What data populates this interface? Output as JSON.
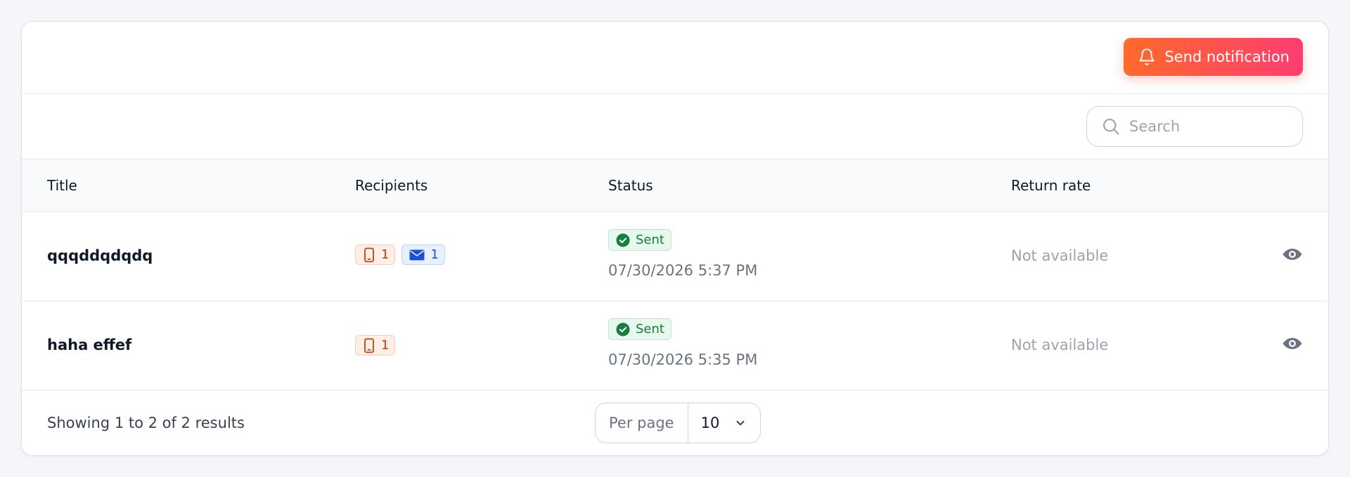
{
  "toolbar": {
    "send_label": "Send notification"
  },
  "search": {
    "placeholder": "Search"
  },
  "table": {
    "columns": {
      "title": "Title",
      "recipients": "Recipients",
      "status": "Status",
      "return_rate": "Return rate"
    },
    "rows": [
      {
        "title": "qqqddqdqdq",
        "recipients": {
          "sms": "1",
          "email": "1"
        },
        "status": "Sent",
        "timestamp": "07/30/2026 5:37 PM",
        "return_rate": "Not available"
      },
      {
        "title": "haha effef",
        "recipients": {
          "sms": "1"
        },
        "status": "Sent",
        "timestamp": "07/30/2026 5:35 PM",
        "return_rate": "Not available"
      }
    ]
  },
  "footer": {
    "results_text": "Showing 1 to 2 of 2 results",
    "per_page_label": "Per page",
    "per_page_value": "10"
  },
  "icons": {
    "send": "bell-icon",
    "search": "search-icon",
    "sms": "phone-icon",
    "email": "envelope-icon",
    "status": "check-circle-icon",
    "view": "eye-icon",
    "select": "chevron-down-icon"
  },
  "colors": {
    "accent_start": "#ff6a2b",
    "accent_end": "#ff3d71",
    "sent_green": "#15803d",
    "sms_orange": "#c2410c",
    "email_blue": "#1d4ed8"
  }
}
